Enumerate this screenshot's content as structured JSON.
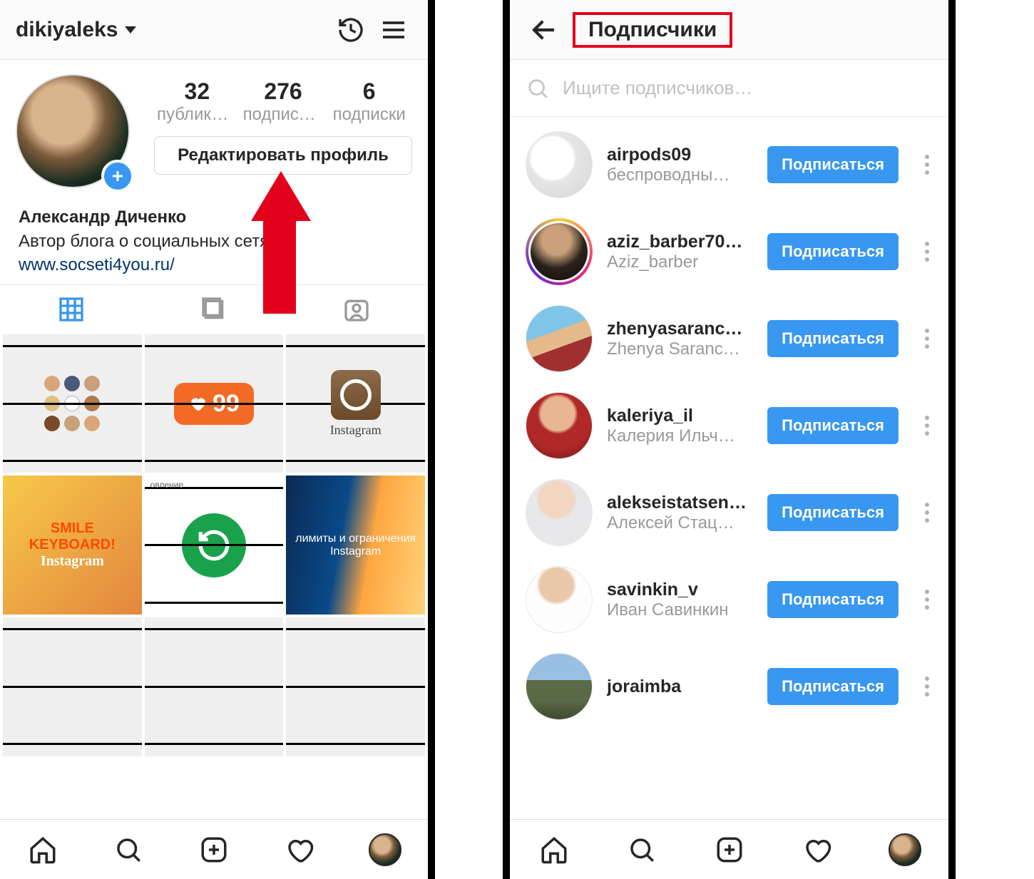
{
  "left": {
    "header": {
      "username": "dikiyaleks"
    },
    "stats": {
      "posts": {
        "count": "32",
        "label": "публика…"
      },
      "followers": {
        "count": "276",
        "label": "подписч…"
      },
      "following": {
        "count": "6",
        "label": "подписки"
      }
    },
    "edit_profile_label": "Редактировать профиль",
    "bio": {
      "display_name": "Александр Диченко",
      "tagline": "Автор блога о социальных сетях",
      "link": "www.socseti4you.ru/"
    },
    "grid": {
      "like_badge": "99",
      "ig_caption": "Instagram",
      "smile_text_1": "SMILE",
      "smile_text_2": "KEYBOARD!",
      "smile_text_3": "Instagram",
      "blur_text": "лимиты и ограничения Instagram",
      "mid_label": "овление"
    }
  },
  "right": {
    "title": "Подписчики",
    "search_placeholder": "Ищите подписчиков…",
    "follow_label": "Подписаться",
    "followers": [
      {
        "user": "airpods09",
        "name": "беспроводны…",
        "ring": false,
        "sw": "sw1"
      },
      {
        "user": "aziz_barber70…",
        "name": "Aziz_barber",
        "ring": true,
        "sw": "sw2"
      },
      {
        "user": "zhenyasaranc…",
        "name": "Zhenya Saranc…",
        "ring": false,
        "sw": "sw3"
      },
      {
        "user": "kaleriya_il",
        "name": "Калерия Ильч…",
        "ring": false,
        "sw": "sw4"
      },
      {
        "user": "alekseistatsen…",
        "name": "Алексей Стац…",
        "ring": false,
        "sw": "sw5"
      },
      {
        "user": "savinkin_v",
        "name": "Иван Савинкин",
        "ring": false,
        "sw": "sw6"
      },
      {
        "user": "joraimba",
        "name": "",
        "ring": false,
        "sw": "sw7"
      }
    ]
  }
}
